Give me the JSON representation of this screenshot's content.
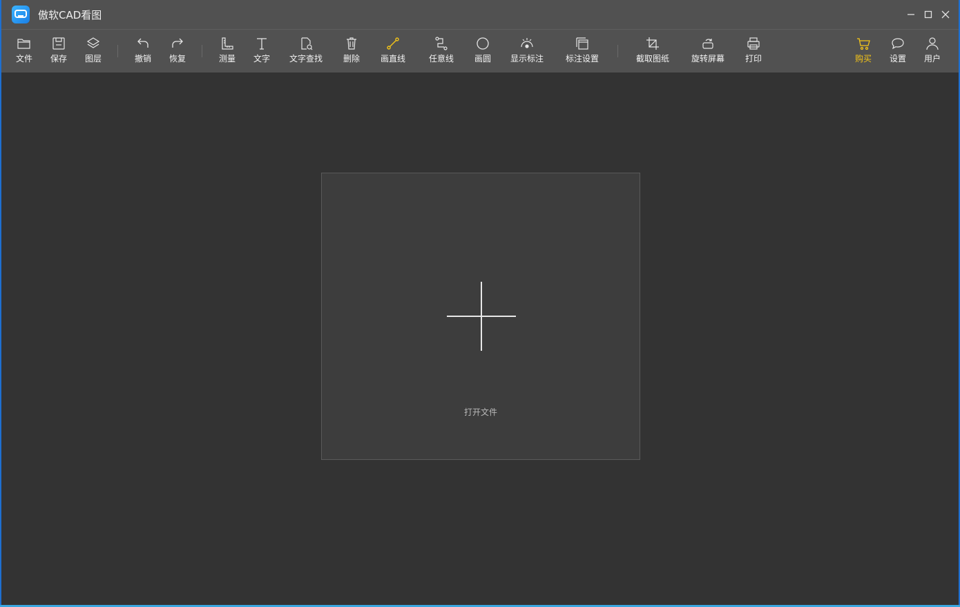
{
  "window": {
    "title": "傲软CAD看图"
  },
  "toolbar": {
    "items": [
      {
        "id": "file",
        "label": "文件",
        "icon": "folder-open-icon"
      },
      {
        "id": "save",
        "label": "保存",
        "icon": "save-icon"
      },
      {
        "id": "layers",
        "label": "图层",
        "icon": "layers-icon"
      },
      {
        "id": "undo",
        "label": "撤销",
        "icon": "undo-icon"
      },
      {
        "id": "redo",
        "label": "恢复",
        "icon": "redo-icon"
      },
      {
        "id": "measure",
        "label": "测量",
        "icon": "ruler-icon"
      },
      {
        "id": "text",
        "label": "文字",
        "icon": "text-icon"
      },
      {
        "id": "text-search",
        "label": "文字查找",
        "icon": "document-search-icon"
      },
      {
        "id": "delete",
        "label": "删除",
        "icon": "trash-icon"
      },
      {
        "id": "draw-line",
        "label": "画直线",
        "icon": "line-tool-icon"
      },
      {
        "id": "polyline",
        "label": "任意线",
        "icon": "polyline-icon"
      },
      {
        "id": "circle",
        "label": "画圆",
        "icon": "circle-icon"
      },
      {
        "id": "show-annotations",
        "label": "显示标注",
        "icon": "annotation-visibility-icon"
      },
      {
        "id": "annotation-settings",
        "label": "标注设置",
        "icon": "annotation-settings-icon"
      },
      {
        "id": "crop",
        "label": "截取图纸",
        "icon": "crop-icon"
      },
      {
        "id": "rotate",
        "label": "旋转屏幕",
        "icon": "rotate-icon"
      },
      {
        "id": "print",
        "label": "打印",
        "icon": "printer-icon"
      },
      {
        "id": "buy",
        "label": "购买",
        "icon": "cart-icon"
      },
      {
        "id": "settings",
        "label": "设置",
        "icon": "chat-bubble-icon"
      },
      {
        "id": "user",
        "label": "用户",
        "icon": "user-icon"
      }
    ]
  },
  "main": {
    "open_file_label": "打开文件"
  },
  "colors": {
    "accent": "#f5c518",
    "toolbar_bg": "#515151",
    "canvas_bg": "#333333",
    "panel_bg": "#3d3d3d"
  }
}
